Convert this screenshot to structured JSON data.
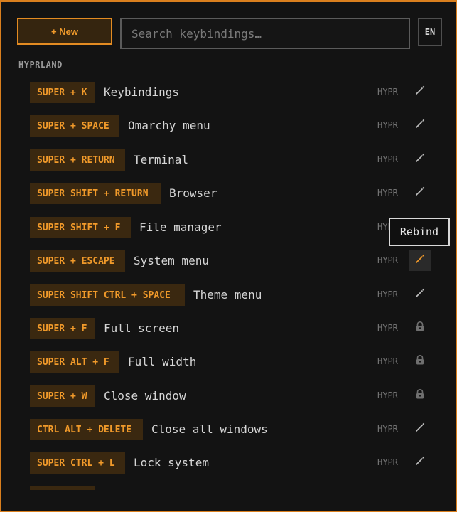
{
  "toolbar": {
    "new_label": "+ New",
    "search_placeholder": "Search keybindings…",
    "language": "EN"
  },
  "section_title": "HYPRLAND",
  "bindings": [
    {
      "keys": "SUPER + K",
      "label": "Keybindings",
      "source": "HYPR",
      "action_icon": "pencil-icon"
    },
    {
      "keys": "SUPER + SPACE",
      "label": "Omarchy menu",
      "source": "HYPR",
      "action_icon": "pencil-icon"
    },
    {
      "keys": "SUPER + RETURN",
      "label": "Terminal",
      "source": "HYPR",
      "action_icon": "pencil-icon"
    },
    {
      "keys": "SUPER SHIFT + RETURN",
      "label": "Browser",
      "source": "HYPR",
      "action_icon": "pencil-icon"
    },
    {
      "keys": "SUPER SHIFT + F",
      "label": "File manager",
      "source": "HYPR",
      "action_icon": "pencil-icon"
    },
    {
      "keys": "SUPER + ESCAPE",
      "label": "System menu",
      "source": "HYPR",
      "action_icon": "pencil-icon"
    },
    {
      "keys": "SUPER SHIFT CTRL + SPACE",
      "label": "Theme menu",
      "source": "HYPR",
      "action_icon": "pencil-icon"
    },
    {
      "keys": "SUPER + F",
      "label": "Full screen",
      "source": "HYPR",
      "action_icon": "lock-icon"
    },
    {
      "keys": "SUPER ALT + F",
      "label": "Full width",
      "source": "HYPR",
      "action_icon": "lock-icon"
    },
    {
      "keys": "SUPER + W",
      "label": "Close window",
      "source": "HYPR",
      "action_icon": "lock-icon"
    },
    {
      "keys": "CTRL ALT + DELETE",
      "label": "Close all windows",
      "source": "HYPR",
      "action_icon": "pencil-icon"
    },
    {
      "keys": "SUPER CTRL + L",
      "label": "Lock system",
      "source": "HYPR",
      "action_icon": "pencil-icon"
    }
  ],
  "tooltip": "Rebind",
  "colors": {
    "accent": "#e38b22",
    "key_background": "#3a2810",
    "active_icon": "#f29a2a",
    "muted_icon": "#bdbdbd",
    "lock_icon": "#6f6f6f"
  }
}
